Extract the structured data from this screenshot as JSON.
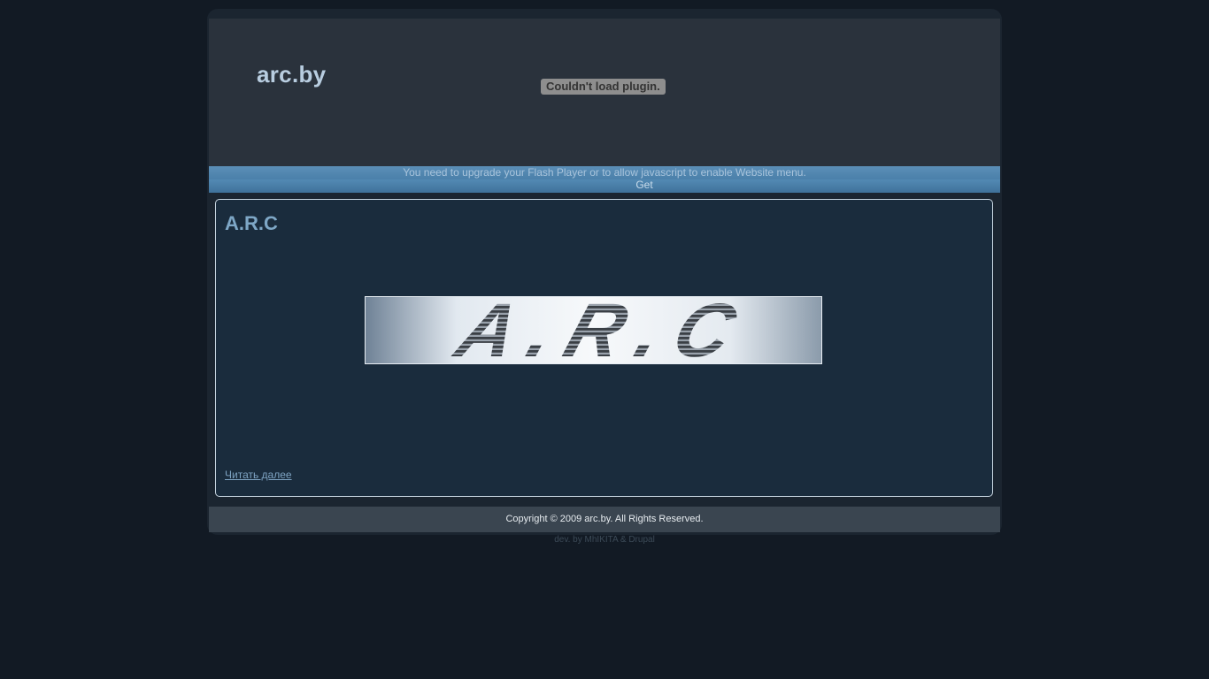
{
  "header": {
    "site_title": "arc.by",
    "plugin_error": "Couldn't load plugin."
  },
  "nav": {
    "flash_notice": "You need to upgrade your Flash Player or to allow javascript to enable Website menu.",
    "get_link": "Get"
  },
  "article": {
    "title": "A.R.C",
    "logo_text": "A.R.C",
    "read_more": "Читать далее"
  },
  "footer": {
    "copyright": "Copyright © 2009 arc.by. All Rights Reserved.",
    "dev_prefix": "dev. by",
    "dev_author": "MhIKITA",
    "dev_sep": "&",
    "dev_cms": "Drupal"
  },
  "colors": {
    "background": "#121a24",
    "header": "#2a323c",
    "nav_bar": "#4b80aa",
    "content": "#1a2c3d",
    "title_text": "#b8cde0",
    "accent_text": "#7ea7c6"
  }
}
